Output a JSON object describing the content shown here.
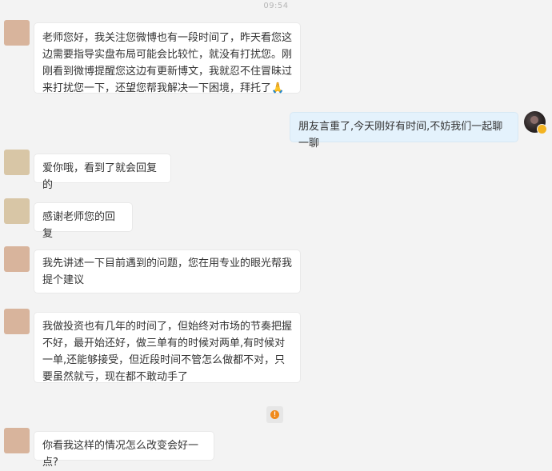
{
  "timestamp": "09:54",
  "messages": [
    {
      "side": "left",
      "text": "老师您好，我关注您微博也有一段时间了，昨天看您这边需要指导实盘布局可能会比较忙，就没有打扰您。刚刚看到微博提醒您这边有更新博文，我就忍不住冒昧过来打扰您一下，还望您帮我解决一下困境，拜托了🙏"
    },
    {
      "side": "right",
      "text": "朋友言重了,今天刚好有时间,不妨我们一起聊一聊"
    },
    {
      "side": "left",
      "text": "爱你哦，看到了就会回复的"
    },
    {
      "side": "left",
      "text": "感谢老师您的回复"
    },
    {
      "side": "left",
      "text": "我先讲述一下目前遇到的问题，您在用专业的眼光帮我提个建议"
    },
    {
      "side": "left",
      "text": "我做投资也有几年的时间了，但始终对市场的节奏把握不好，最开始还好，做三单有的时候对两单,有时候对一单,还能够接受，但近段时间不管怎么做都不对，只要虽然就亏，现在都不敢动手了"
    },
    {
      "side": "left",
      "text": "你看我这样的情况怎么改变会好一点?"
    }
  ],
  "info_icon": "exclamation-info-icon",
  "colors": {
    "background": "#f3f3f3",
    "bubble_left": "#ffffff",
    "bubble_right": "#e4f2fc",
    "avatar_a": "#d8b49c",
    "avatar_b": "#d8c6a6",
    "info_accent": "#f08a1c"
  }
}
